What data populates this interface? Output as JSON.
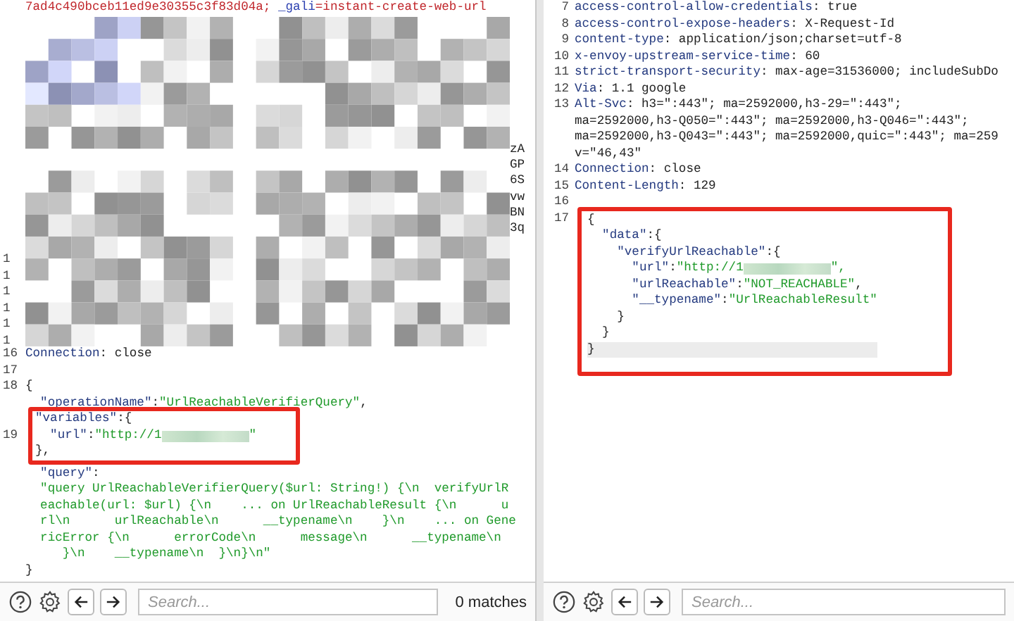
{
  "request_pane": {
    "cookie_line": [
      {
        "text": "7ad4c490bceb11ed9e30355c3f83d04a;",
        "kind": "red"
      },
      {
        "text": " _gali",
        "kind": "blue"
      },
      {
        "text": "=instant-create-web-url",
        "kind": "red"
      }
    ],
    "redacted_area": {
      "line_numbers": [
        "1",
        "1",
        "1",
        "1",
        "1",
        "1"
      ],
      "edge_fragments": [
        "zA",
        "GP",
        "6S",
        "vw",
        "BN",
        "3q"
      ]
    },
    "lines": [
      {
        "kind": "line",
        "num": "16",
        "segs": [
          {
            "text": "Connection",
            "kind": "hname"
          },
          {
            "text": ": close",
            "kind": "plain"
          }
        ]
      },
      {
        "kind": "line",
        "num": "17"
      },
      {
        "kind": "line",
        "num": "18",
        "segs": [
          {
            "text": "{",
            "kind": "plain"
          }
        ]
      },
      {
        "kind": "line",
        "segs": [
          {
            "text": "  \"operationName\"",
            "kind": "key"
          },
          {
            "text": ":",
            "kind": "plain"
          },
          {
            "text": "\"UrlReachableVerifierQuery\"",
            "kind": "str"
          },
          {
            "text": ",",
            "kind": "plain"
          }
        ]
      },
      {
        "kind": "box",
        "lines": [
          {
            "kind": "line",
            "segs": [
              {
                "text": "\"variables\"",
                "kind": "key"
              },
              {
                "text": ":{",
                "kind": "plain"
              }
            ]
          },
          {
            "kind": "line",
            "num": "19",
            "segs": [
              {
                "text": "  \"url\"",
                "kind": "key"
              },
              {
                "text": ":",
                "kind": "plain"
              },
              {
                "text": "\"http://1",
                "kind": "str"
              },
              {
                "kind": "blur"
              },
              {
                "text": "\"",
                "kind": "str"
              }
            ]
          },
          {
            "kind": "line",
            "segs": [
              {
                "text": "},",
                "kind": "plain"
              }
            ]
          }
        ]
      },
      {
        "kind": "line",
        "segs": [
          {
            "text": "  \"query\"",
            "kind": "key"
          },
          {
            "text": ":",
            "kind": "plain"
          }
        ]
      },
      {
        "kind": "line",
        "segs": [
          {
            "text": "  \"query UrlReachableVerifierQuery($url: String!) {\\n  verifyUrlR",
            "kind": "str"
          }
        ]
      },
      {
        "kind": "line",
        "segs": [
          {
            "text": "  eachable(url: $url) {\\n    ... on UrlReachableResult {\\n      u",
            "kind": "str"
          }
        ]
      },
      {
        "kind": "line",
        "segs": [
          {
            "text": "  rl\\n      urlReachable\\n      __typename\\n    }\\n    ... on Gene",
            "kind": "str"
          }
        ]
      },
      {
        "kind": "line",
        "segs": [
          {
            "text": "  ricError {\\n      errorCode\\n      message\\n      __typename\\n",
            "kind": "str"
          }
        ]
      },
      {
        "kind": "line",
        "segs": [
          {
            "text": "     }\\n    __typename\\n  }\\n}\\n\"",
            "kind": "str"
          }
        ]
      },
      {
        "kind": "line",
        "segs": [
          {
            "text": "}",
            "kind": "plain"
          }
        ]
      }
    ]
  },
  "response_pane": {
    "lines": [
      {
        "kind": "line",
        "num": "7",
        "segs": [
          {
            "text": "access-control-allow-credentials",
            "kind": "hname"
          },
          {
            "text": ": true",
            "kind": "plain"
          }
        ]
      },
      {
        "kind": "line",
        "num": "8",
        "segs": [
          {
            "text": "access-control-expose-headers",
            "kind": "hname"
          },
          {
            "text": ": X-Request-Id",
            "kind": "plain"
          }
        ]
      },
      {
        "kind": "line",
        "num": "9",
        "segs": [
          {
            "text": "content-type",
            "kind": "hname"
          },
          {
            "text": ": application/json;charset=utf-8",
            "kind": "plain"
          }
        ]
      },
      {
        "kind": "line",
        "num": "10",
        "segs": [
          {
            "text": "x-envoy-upstream-service-time",
            "kind": "hname"
          },
          {
            "text": ": 60",
            "kind": "plain"
          }
        ]
      },
      {
        "kind": "line",
        "num": "11",
        "segs": [
          {
            "text": "strict-transport-security",
            "kind": "hname"
          },
          {
            "text": ": max-age=31536000; includeSubDo",
            "kind": "plain"
          }
        ]
      },
      {
        "kind": "line",
        "num": "12",
        "segs": [
          {
            "text": "Via",
            "kind": "hname"
          },
          {
            "text": ": 1.1 google",
            "kind": "plain"
          }
        ]
      },
      {
        "kind": "line",
        "num": "13",
        "segs": [
          {
            "text": "Alt-Svc",
            "kind": "hname"
          },
          {
            "text": ": h3=\":443\"; ma=2592000,h3-29=\":443\";",
            "kind": "plain"
          }
        ]
      },
      {
        "kind": "line",
        "segs": [
          {
            "text": "ma=2592000,h3-Q050=\":443\"; ma=2592000,h3-Q046=\":443\";",
            "kind": "plain"
          }
        ]
      },
      {
        "kind": "line",
        "segs": [
          {
            "text": "ma=2592000,h3-Q043=\":443\"; ma=2592000,quic=\":443\"; ma=259",
            "kind": "plain"
          }
        ]
      },
      {
        "kind": "line",
        "segs": [
          {
            "text": "v=\"46,43\"",
            "kind": "plain"
          }
        ]
      },
      {
        "kind": "line",
        "num": "14",
        "segs": [
          {
            "text": "Connection",
            "kind": "hname"
          },
          {
            "text": ": close",
            "kind": "plain"
          }
        ]
      },
      {
        "kind": "line",
        "num": "15",
        "segs": [
          {
            "text": "Content-Length",
            "kind": "hname"
          },
          {
            "text": ": 129",
            "kind": "plain"
          }
        ]
      },
      {
        "kind": "line",
        "num": "16"
      },
      {
        "kind": "box",
        "lines": [
          {
            "kind": "line",
            "num": "17",
            "segs": [
              {
                "text": "{",
                "kind": "plain"
              }
            ]
          },
          {
            "kind": "line",
            "segs": [
              {
                "text": "  \"data\"",
                "kind": "key"
              },
              {
                "text": ":{",
                "kind": "plain"
              }
            ]
          },
          {
            "kind": "line",
            "segs": [
              {
                "text": "    \"verifyUrlReachable\"",
                "kind": "key"
              },
              {
                "text": ":{",
                "kind": "plain"
              }
            ]
          },
          {
            "kind": "line",
            "segs": [
              {
                "text": "      \"url\"",
                "kind": "key"
              },
              {
                "text": ":",
                "kind": "plain"
              },
              {
                "text": "\"http://1",
                "kind": "str"
              },
              {
                "kind": "blur"
              },
              {
                "text": "\",",
                "kind": "str"
              }
            ]
          },
          {
            "kind": "line",
            "segs": [
              {
                "text": "      \"urlReachable\"",
                "kind": "key"
              },
              {
                "text": ":",
                "kind": "plain"
              },
              {
                "text": "\"NOT_REACHABLE\"",
                "kind": "str"
              },
              {
                "text": ",",
                "kind": "plain"
              }
            ]
          },
          {
            "kind": "line",
            "segs": [
              {
                "text": "      \"__typename\"",
                "kind": "key"
              },
              {
                "text": ":",
                "kind": "plain"
              },
              {
                "text": "\"UrlReachableResult\"",
                "kind": "str"
              }
            ]
          },
          {
            "kind": "line",
            "segs": [
              {
                "text": "    }",
                "kind": "plain"
              }
            ]
          },
          {
            "kind": "line",
            "segs": [
              {
                "text": "  }",
                "kind": "plain"
              }
            ]
          },
          {
            "kind": "line",
            "current_line": true,
            "segs": [
              {
                "text": "}",
                "kind": "plain"
              }
            ]
          }
        ]
      }
    ]
  },
  "toolbars": [
    {
      "search_placeholder": "Search...",
      "match_count": "0 matches"
    },
    {
      "search_placeholder": "Search..."
    }
  ]
}
